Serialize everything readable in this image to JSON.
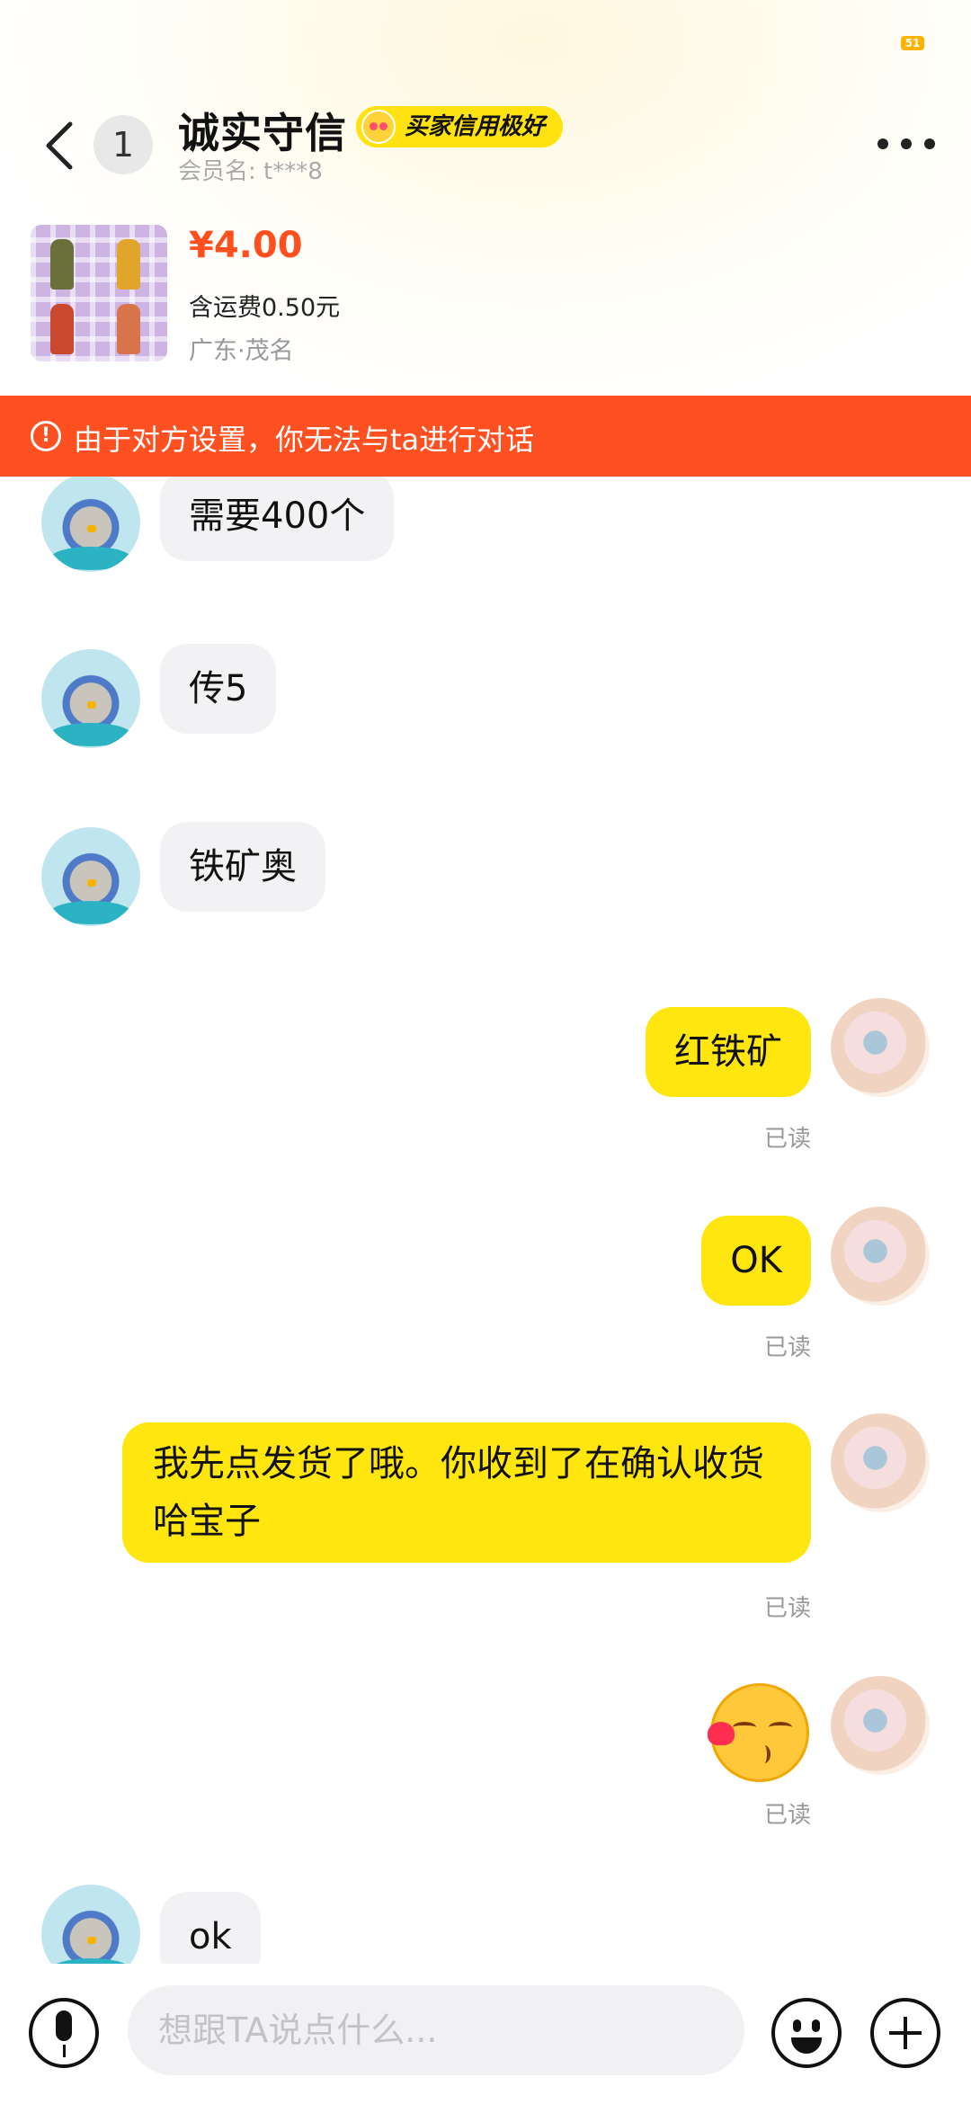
{
  "status_bar": {
    "battery": "51"
  },
  "header": {
    "unread_count": "1",
    "contact_name": "诚实守信",
    "credit_badge": "买家信用极好",
    "member_name": "会员名: t***8"
  },
  "product": {
    "price": "¥4.00",
    "shipping": "含运费0.50元",
    "location": "广东·茂名"
  },
  "warning": {
    "text": "由于对方设置，你无法与ta进行对话"
  },
  "messages": {
    "m1": {
      "text": "需要400个"
    },
    "m2": {
      "text": "传5"
    },
    "m3": {
      "text": "铁矿奥"
    },
    "m4": {
      "text": "红铁矿",
      "status": "已读"
    },
    "m5": {
      "text": "OK",
      "status": "已读"
    },
    "m6": {
      "text": "我先点发货了哦。你收到了在确认收货哈宝子",
      "status": "已读"
    },
    "m7": {
      "emoji": "kissing-face-with-heart",
      "status": "已读"
    },
    "m8": {
      "text": "ok"
    }
  },
  "input_bar": {
    "placeholder": "想跟TA说点什么..."
  },
  "colors": {
    "accent_yellow": "#ffe60f",
    "warning_orange": "#ff5022",
    "price_orange": "#ff4f1f"
  }
}
